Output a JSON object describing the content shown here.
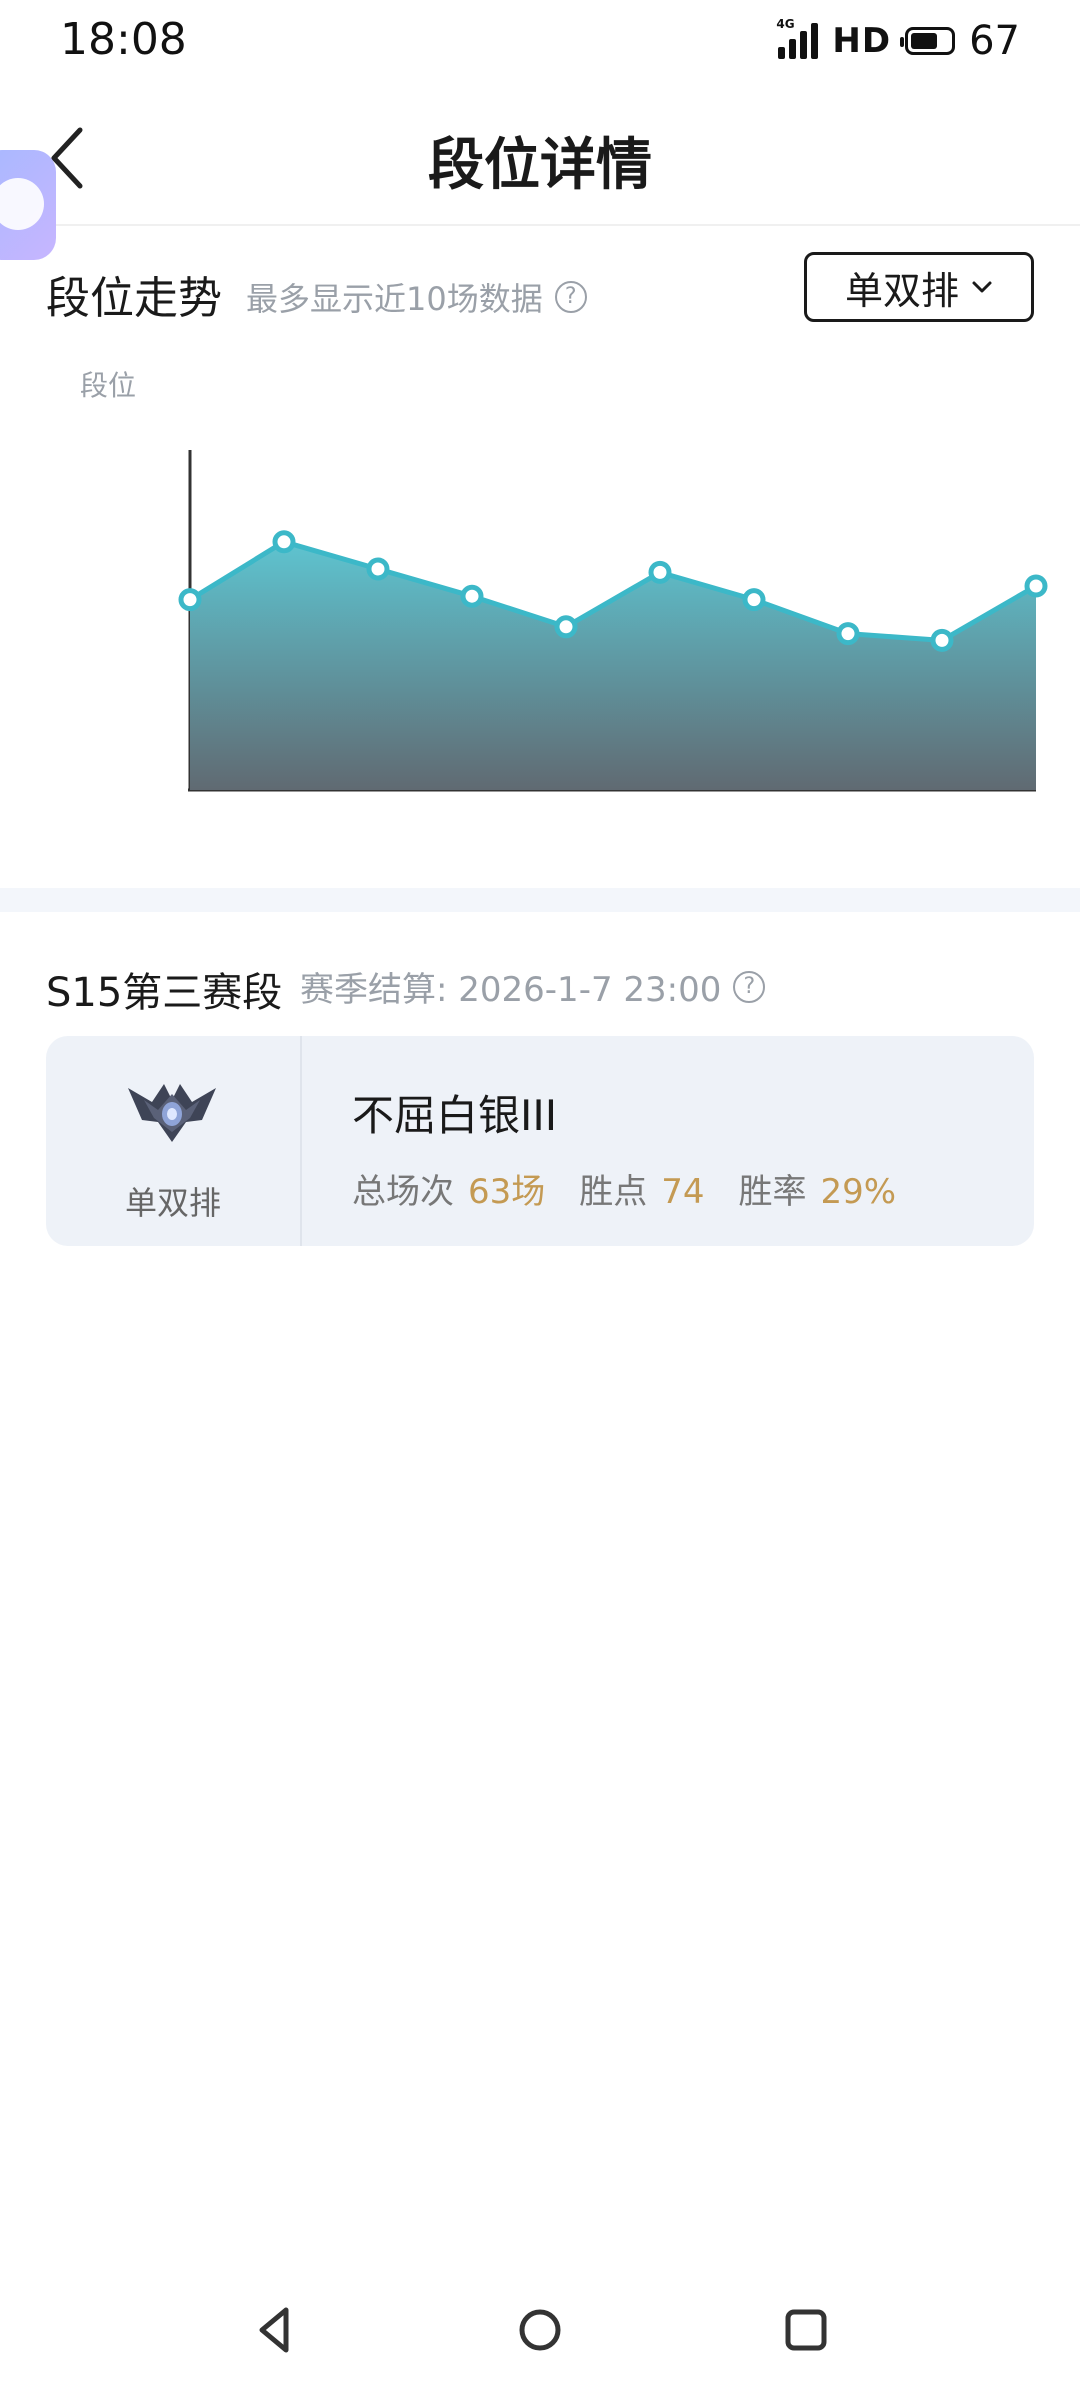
{
  "status": {
    "time": "18:08",
    "network": "4G",
    "hd": "HD",
    "battery": "67"
  },
  "header": {
    "title": "段位详情"
  },
  "trend": {
    "title": "段位走势",
    "subtitle": "最多显示近10场数据",
    "mode_select": "单双排",
    "y_axis_label": "段位"
  },
  "chart_data": {
    "type": "area",
    "x": [
      1,
      2,
      3,
      4,
      5,
      6,
      7,
      8,
      9,
      10
    ],
    "values": [
      56,
      73,
      65,
      57,
      48,
      64,
      56,
      46,
      44,
      60
    ],
    "ylim": [
      0,
      100
    ],
    "fill_top": "#5ec4d0",
    "fill_bottom": "#606a72",
    "line_color": "#3cb8c8",
    "xlabel": "",
    "ylabel": "段位"
  },
  "season": {
    "title": "S15第三赛段",
    "settlement": "赛季结算: 2026-1-7 23:00"
  },
  "rank_card": {
    "mode": "单双排",
    "rank_name": "不屈白银III",
    "stats": [
      {
        "label": "总场次",
        "value": "63场"
      },
      {
        "label": "胜点",
        "value": "74"
      },
      {
        "label": "胜率",
        "value": "29%"
      }
    ]
  }
}
